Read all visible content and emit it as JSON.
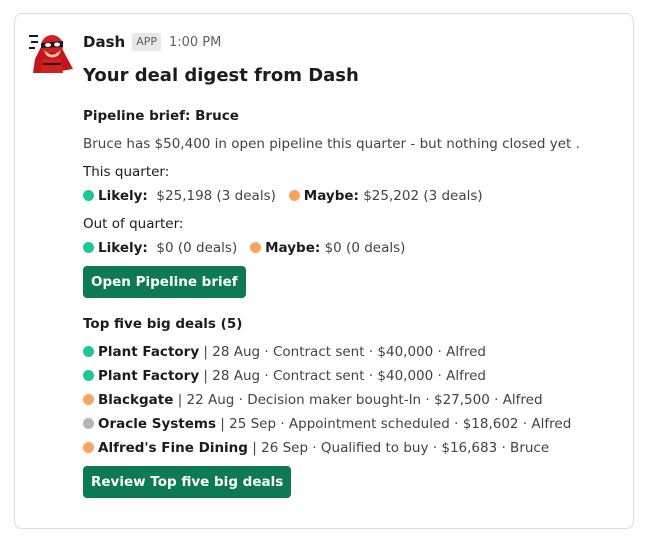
{
  "message": {
    "sender": "Dash",
    "badge": "APP",
    "time": "1:00 PM",
    "title": "Your deal digest from Dash"
  },
  "pipeline": {
    "heading": "Pipeline brief: Bruce",
    "summary": "Bruce has $50,400 in open pipeline this quarter - but nothing closed yet .",
    "this_quarter_label": "This quarter:",
    "this_quarter": {
      "likely_label": "Likely:",
      "likely_value": "$25,198 (3 deals)",
      "maybe_label": "Maybe:",
      "maybe_value": "$25,202 (3 deals)"
    },
    "out_quarter_label": "Out of quarter:",
    "out_quarter": {
      "likely_label": "Likely:",
      "likely_value": "$0 (0 deals)",
      "maybe_label": "Maybe:",
      "maybe_value": "$0 (0 deals)"
    },
    "button": "Open Pipeline brief"
  },
  "top_deals": {
    "heading": "Top five big deals (5)",
    "items": [
      {
        "name": "Plant Factory",
        "details": "| 28 Aug · Contract sent · $40,000 · Alfred",
        "status": "green"
      },
      {
        "name": "Plant Factory",
        "details": "| 28 Aug · Contract sent · $40,000 · Alfred",
        "status": "green"
      },
      {
        "name": "Blackgate",
        "details": "| 22 Aug · Decision maker bought-In · $27,500 · Alfred",
        "status": "orange"
      },
      {
        "name": "Oracle Systems",
        "details": "| 25 Sep · Appointment scheduled · $18,602 · Alfred",
        "status": "gray"
      },
      {
        "name": "Alfred's Fine Dining",
        "details": "| 26 Sep · Qualified to buy · $16,683 · Bruce",
        "status": "orange"
      }
    ],
    "button": "Review Top five big deals"
  },
  "colors": {
    "likely": "#1ec49a",
    "maybe": "#f5a65b",
    "unknown": "#b5b5b5",
    "button": "#0e7a55"
  },
  "icons": {
    "avatar": "superhero-avatar-icon"
  }
}
